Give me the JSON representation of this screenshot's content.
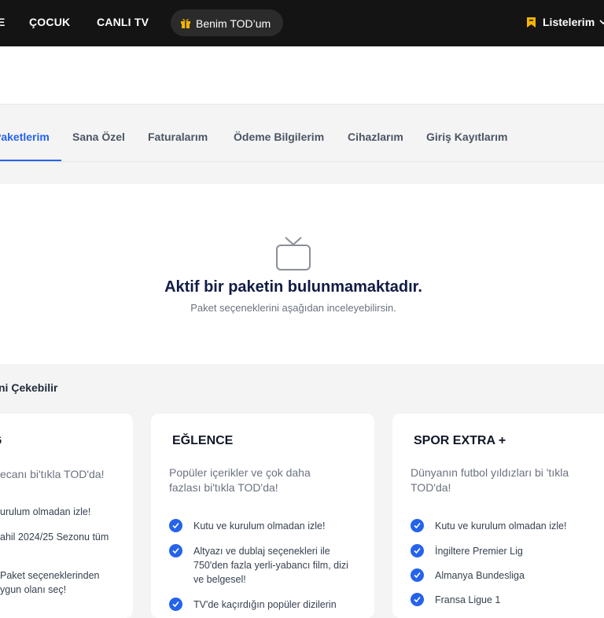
{
  "nav": {
    "edge_fragment": "E",
    "items": [
      "ÇOCUK",
      "CANLI TV"
    ],
    "benim_todum": "Benim TOD’um",
    "listelerim": "Listelerim"
  },
  "tabs": [
    {
      "label": "Paketlerim",
      "active": true
    },
    {
      "label": "Sana Özel"
    },
    {
      "label": "Faturalarım"
    },
    {
      "label": "Ödeme Bilgilerim"
    },
    {
      "label": "Cihazlarım"
    },
    {
      "label": "Giriş Kayıtlarım"
    }
  ],
  "empty_state": {
    "icon": "tv-icon",
    "title": "Aktif bir paketin bulunmamaktadır.",
    "subtitle": "Paket seçeneklerini aşağıdan inceleyebilirsin."
  },
  "section_title": "ni Çekebilir",
  "cards": [
    {
      "title": "G",
      "description": "ecanı bi'tıkla TOD'da!",
      "features": [
        "urulum olmadan izle!",
        "ahil 2024/25 Sezonu tüm",
        "Paket seçeneklerinden",
        "ygun olanı seç!"
      ]
    },
    {
      "title": "EĞLENCE",
      "description": "Popüler içerikler ve çok daha fazlası bi'tıkla TOD'da!",
      "features": [
        "Kutu ve kurulum olmadan izle!",
        "Altyazı ve dublaj seçenekleri ile 750'den fazla yerli-yabancı film, dizi ve belgesel!",
        "TV'de kaçırdığın popüler dizilerin"
      ]
    },
    {
      "title": "SPOR EXTRA +",
      "description": "Dünyanın futbol yıldızları bi 'tıkla TOD'da!",
      "features": [
        "Kutu ve kurulum olmadan izle!",
        "İngiltere Premier Lig",
        "Almanya Bundesliga",
        "Fransa Ligue 1"
      ]
    }
  ],
  "colors": {
    "accent": "#2563eb",
    "nav_bg": "#141414",
    "gift": "#f5b301"
  }
}
